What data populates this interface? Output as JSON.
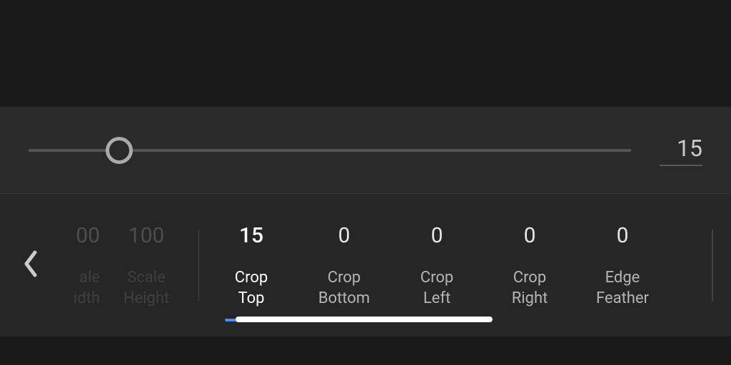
{
  "slider": {
    "value": "15",
    "position_percent": 15
  },
  "params": {
    "clipped": {
      "scale_width": {
        "value": "00",
        "label": "ale\nidth"
      }
    },
    "items": [
      {
        "value": "100",
        "label": "Scale\nHeight",
        "active": false,
        "dimmed": true
      },
      {
        "value": "15",
        "label": "Crop\nTop",
        "active": true,
        "dimmed": false
      },
      {
        "value": "0",
        "label": "Crop\nBottom",
        "active": false,
        "dimmed": false
      },
      {
        "value": "0",
        "label": "Crop\nLeft",
        "active": false,
        "dimmed": false
      },
      {
        "value": "0",
        "label": "Crop\nRight",
        "active": false,
        "dimmed": false
      },
      {
        "value": "0",
        "label": "Edge\nFeather",
        "active": false,
        "dimmed": false
      }
    ]
  }
}
